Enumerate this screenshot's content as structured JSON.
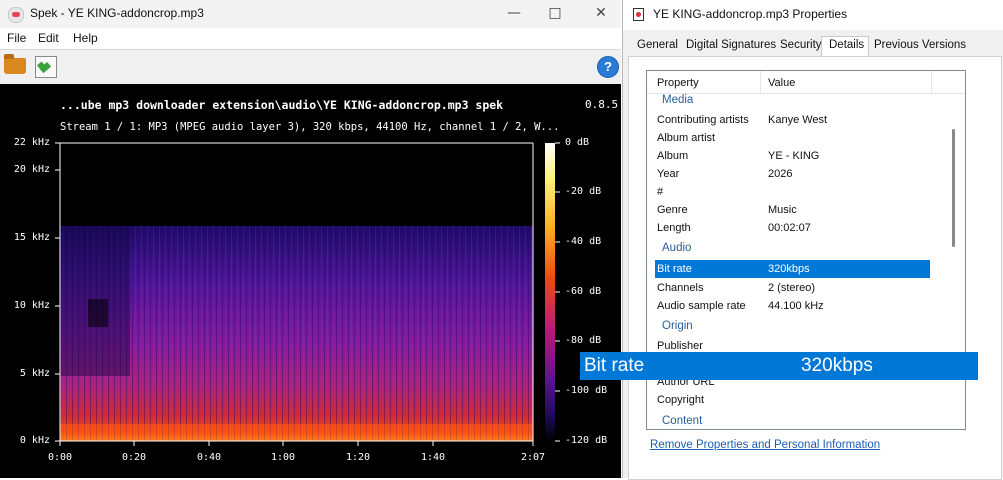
{
  "spek": {
    "window_title": "Spek - YE KING-addoncrop.mp3",
    "menu": [
      "File",
      "Edit",
      "Help"
    ],
    "header_path": "...ube mp3 downloader extension\\audio\\YE KING-addoncrop.mp3  spek",
    "version": "0.8.5",
    "stream_info": "Stream 1 / 1: MP3 (MPEG audio layer 3), 320 kbps, 44100 Hz, channel 1 / 2, W...",
    "freq_labels": [
      "22 kHz",
      "20 kHz",
      "15 kHz",
      "10 kHz",
      "5 kHz",
      "0 kHz"
    ],
    "time_labels": [
      "0:00",
      "0:20",
      "0:40",
      "1:00",
      "1:20",
      "1:40",
      "2:07"
    ],
    "db_labels": [
      "0 dB",
      "-20 dB",
      "-40 dB",
      "-60 dB",
      "-80 dB",
      "-100 dB",
      "-120 dB"
    ]
  },
  "chart_data": {
    "type": "heatmap",
    "x_axis": {
      "ticks": [
        "0:00",
        "0:20",
        "0:40",
        "1:00",
        "1:20",
        "1:40",
        "2:07"
      ],
      "range_seconds": [
        0,
        127
      ]
    },
    "y_axis": {
      "ticks": [
        "0 kHz",
        "5 kHz",
        "10 kHz",
        "15 kHz",
        "20 kHz",
        "22 kHz"
      ],
      "range_khz": [
        0,
        22
      ]
    },
    "colorbar": {
      "ticks": [
        "0 dB",
        "-20 dB",
        "-40 dB",
        "-60 dB",
        "-80 dB",
        "-100 dB",
        "-120 dB"
      ],
      "range_db": [
        -120,
        0
      ]
    },
    "frequency_cutoff_khz": 16
  },
  "props": {
    "window_title": "YE KING-addoncrop.mp3 Properties",
    "tabs": [
      "General",
      "Digital Signatures",
      "Security",
      "Details",
      "Previous Versions"
    ],
    "selected_tab": "Details",
    "col_property": "Property",
    "col_value": "Value",
    "groups": {
      "media": "Media",
      "audio": "Audio",
      "origin": "Origin",
      "content": "Content"
    },
    "rows": [
      {
        "k": "Contributing artists",
        "v": "Kanye West"
      },
      {
        "k": "Album artist",
        "v": ""
      },
      {
        "k": "Album",
        "v": "YE - KING"
      },
      {
        "k": "Year",
        "v": "2026"
      },
      {
        "k": "#",
        "v": ""
      },
      {
        "k": "Genre",
        "v": "Music"
      },
      {
        "k": "Length",
        "v": "00:02:07"
      },
      {
        "k": "Bit rate",
        "v": "320kbps"
      },
      {
        "k": "Channels",
        "v": "2 (stereo)"
      },
      {
        "k": "Audio sample rate",
        "v": "44.100 kHz"
      },
      {
        "k": "Publisher",
        "v": ""
      },
      {
        "k": "Author URL",
        "v": ""
      },
      {
        "k": "Copyright",
        "v": ""
      }
    ],
    "remove_link": "Remove Properties and Personal Information",
    "tooltip": {
      "k": "Bit rate",
      "v": "320kbps"
    }
  },
  "colors": {
    "accent": "#0078d7",
    "group_text": "#2a5f97",
    "link": "#1a5fb4"
  }
}
